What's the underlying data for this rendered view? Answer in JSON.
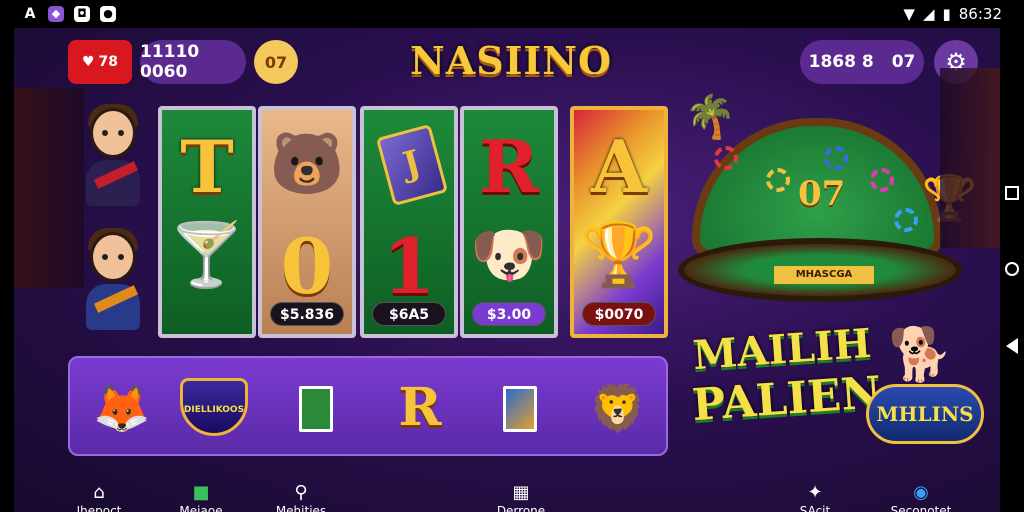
{
  "status_bar": {
    "left_icons": [
      "A",
      "◆",
      "◘",
      "●"
    ],
    "time": "86:32",
    "signal_icons": [
      "wifi-icon",
      "signal-icon",
      "battery-icon"
    ]
  },
  "top_bar": {
    "hearts_value": "78",
    "coins_value": "11110 0060",
    "level_value": "07",
    "right_value_a": "1868 8",
    "right_value_b": "07"
  },
  "logo": {
    "title": "NASIINO"
  },
  "reels": {
    "reel1": {
      "top": "T",
      "bottom_icon": "cocktail-icon"
    },
    "reel2": {
      "top_icon": "bear-icon",
      "bottom": "0",
      "value": "$5.836"
    },
    "reel3": {
      "top_card": "J",
      "bottom": "1",
      "value": "$6A5"
    },
    "reel4": {
      "top": "R",
      "bottom_icon": "dog-icon",
      "value": "$3.00"
    },
    "reel5": {
      "top": "A",
      "bottom_icon": "trophy-icon",
      "value": "$0070"
    }
  },
  "table": {
    "number": "07",
    "label": "MHASCGA"
  },
  "badges": {
    "main_line1": "MAILIH",
    "main_line2": "PALIEN",
    "side": "MHLINS"
  },
  "tray": {
    "items": [
      {
        "icon": "fox-icon"
      },
      {
        "text": "DIELLIKOOS"
      },
      {
        "icon": "green-card-icon"
      },
      {
        "text": "R"
      },
      {
        "icon": "blue-card-icon"
      },
      {
        "icon": "lion-coin-icon"
      }
    ]
  },
  "bottom_nav": {
    "items": [
      {
        "label": "Ihepoct",
        "icon": "home-icon"
      },
      {
        "label": "Meiaoe",
        "icon": "gift-icon"
      },
      {
        "label": "Mehities",
        "icon": "search-icon"
      },
      {
        "label": "Derrone",
        "icon": "store-icon"
      },
      {
        "label": "SAcit",
        "icon": "puzzle-icon"
      },
      {
        "label": "Seconotet",
        "icon": "chat-icon"
      }
    ]
  },
  "colors": {
    "accent_gold": "#f6c33a",
    "accent_purple": "#7a3bd0",
    "danger_red": "#d9171e"
  }
}
